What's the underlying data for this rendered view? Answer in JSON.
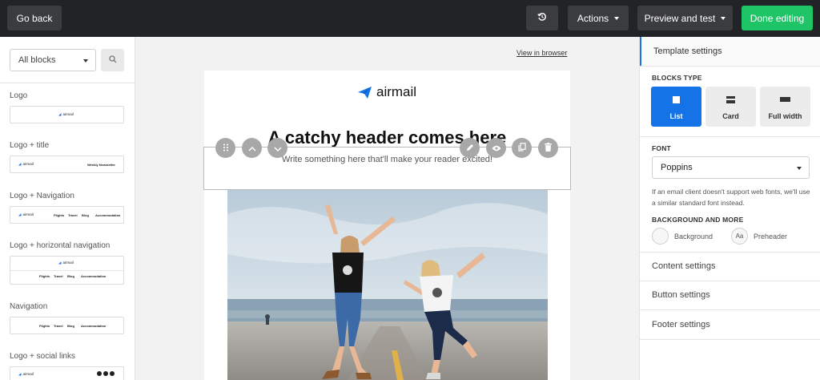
{
  "topbar": {
    "go_back": "Go back",
    "history_icon": "history-icon",
    "actions": "Actions",
    "preview_test": "Preview and test",
    "done": "Done editing",
    "done_color": "#1fc467"
  },
  "blocks_panel": {
    "filter": "All blocks",
    "items": [
      {
        "label": "Logo"
      },
      {
        "label": "Logo + title",
        "preview_title": "Weekly Newsletter"
      },
      {
        "label": "Logo + Navigation",
        "preview_links": [
          "Flights",
          "Travel",
          "Blog",
          "Accommodation"
        ]
      },
      {
        "label": "Logo + horizontal navigation",
        "preview_links": [
          "Flights",
          "Travel",
          "Blog",
          "Accommodation"
        ]
      },
      {
        "label": "Navigation",
        "preview_links": [
          "Flights",
          "Travel",
          "Blog",
          "Accommodation"
        ]
      },
      {
        "label": "Logo + social links"
      }
    ],
    "mini_logo": "airmail"
  },
  "canvas": {
    "view_in_browser": "View in browser",
    "brand": "airmail",
    "headline": "A catchy header comes here",
    "subtext": "Write something here that'll make your reader excited!",
    "block_tools_left": [
      "drag-handle-icon",
      "move-up-icon",
      "move-down-icon"
    ],
    "block_tools_right": [
      "edit-icon",
      "preview-eye-icon",
      "duplicate-icon",
      "delete-icon"
    ]
  },
  "settings": {
    "title": "Template settings",
    "blocks_type_caption": "BLOCKS TYPE",
    "blocks_types": [
      {
        "label": "List",
        "active": true
      },
      {
        "label": "Card",
        "active": false
      },
      {
        "label": "Full width",
        "active": false
      }
    ],
    "font_caption": "FONT",
    "font_value": "Poppins",
    "font_hint": "If an email client doesn't support web fonts, we'll use a similar standard font instead.",
    "bg_caption": "BACKGROUND AND MORE",
    "background": "Background",
    "preheader_glyph": "Aa",
    "preheader": "Preheader",
    "sections": [
      "Content settings",
      "Button settings",
      "Footer settings"
    ],
    "accent_color": "#1473e6"
  }
}
